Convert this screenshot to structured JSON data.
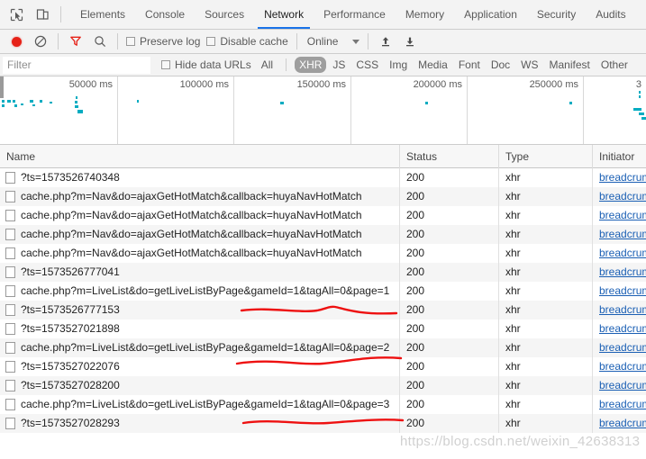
{
  "window": {
    "app": "Chrome DevTools",
    "active_panel": "Network"
  },
  "tabbar": {
    "inspect_icon": "inspect-cursor-icon",
    "device_icon": "device-toolbar-icon",
    "tabs": [
      {
        "label": "Elements",
        "active": false
      },
      {
        "label": "Console",
        "active": false
      },
      {
        "label": "Sources",
        "active": false
      },
      {
        "label": "Network",
        "active": true
      },
      {
        "label": "Performance",
        "active": false
      },
      {
        "label": "Memory",
        "active": false
      },
      {
        "label": "Application",
        "active": false
      },
      {
        "label": "Security",
        "active": false
      },
      {
        "label": "Audits",
        "active": false
      }
    ],
    "accent_color": "#1a73e8"
  },
  "toolbar": {
    "record_label": "record-button",
    "record_color": "#e62117",
    "clear_label": "clear-button",
    "filter_label": "filter-button",
    "filter_color": "#e62117",
    "search_label": "search-button",
    "preserve_log_label": "Preserve log",
    "preserve_log_checked": false,
    "disable_cache_label": "Disable cache",
    "disable_cache_checked": false,
    "throttle_value": "Online",
    "import_label": "import-har-button",
    "export_label": "export-har-button"
  },
  "filterbar": {
    "filter_placeholder": "Filter",
    "filter_value": "",
    "hide_data_urls_label": "Hide data URLs",
    "hide_data_urls_checked": false,
    "types": [
      {
        "label": "All",
        "active": false
      },
      {
        "label": "XHR",
        "active": true
      },
      {
        "label": "JS",
        "active": false
      },
      {
        "label": "CSS",
        "active": false
      },
      {
        "label": "Img",
        "active": false
      },
      {
        "label": "Media",
        "active": false
      },
      {
        "label": "Font",
        "active": false
      },
      {
        "label": "Doc",
        "active": false
      },
      {
        "label": "WS",
        "active": false
      },
      {
        "label": "Manifest",
        "active": false
      },
      {
        "label": "Other",
        "active": false
      }
    ],
    "active_pill_color": "#9e9e9e"
  },
  "overview": {
    "tick_labels": [
      "50000 ms",
      "100000 ms",
      "150000 ms",
      "200000 ms",
      "250000 ms",
      "3"
    ],
    "bar_color": "#00acc1"
  },
  "table": {
    "columns": [
      "Name",
      "Status",
      "Type",
      "Initiator"
    ],
    "rows": [
      {
        "name": "?ts=1573526740348",
        "status": "200",
        "type": "xhr",
        "initiator": "breadcrumb"
      },
      {
        "name": "cache.php?m=Nav&do=ajaxGetHotMatch&callback=huyaNavHotMatch",
        "status": "200",
        "type": "xhr",
        "initiator": "breadcrumb"
      },
      {
        "name": "cache.php?m=Nav&do=ajaxGetHotMatch&callback=huyaNavHotMatch",
        "status": "200",
        "type": "xhr",
        "initiator": "breadcrumb"
      },
      {
        "name": "cache.php?m=Nav&do=ajaxGetHotMatch&callback=huyaNavHotMatch",
        "status": "200",
        "type": "xhr",
        "initiator": "breadcrumb"
      },
      {
        "name": "cache.php?m=Nav&do=ajaxGetHotMatch&callback=huyaNavHotMatch",
        "status": "200",
        "type": "xhr",
        "initiator": "breadcrumb"
      },
      {
        "name": "?ts=1573526777041",
        "status": "200",
        "type": "xhr",
        "initiator": "breadcrumb"
      },
      {
        "name": "cache.php?m=LiveList&do=getLiveListByPage&gameId=1&tagAll=0&page=1",
        "status": "200",
        "type": "xhr",
        "initiator": "breadcrumb"
      },
      {
        "name": "?ts=1573526777153",
        "status": "200",
        "type": "xhr",
        "initiator": "breadcrumb"
      },
      {
        "name": "?ts=1573527021898",
        "status": "200",
        "type": "xhr",
        "initiator": "breadcrumb"
      },
      {
        "name": "cache.php?m=LiveList&do=getLiveListByPage&gameId=1&tagAll=0&page=2",
        "status": "200",
        "type": "xhr",
        "initiator": "breadcrumb"
      },
      {
        "name": "?ts=1573527022076",
        "status": "200",
        "type": "xhr",
        "initiator": "breadcrumb"
      },
      {
        "name": "?ts=1573527028200",
        "status": "200",
        "type": "xhr",
        "initiator": "breadcrumb"
      },
      {
        "name": "cache.php?m=LiveList&do=getLiveListByPage&gameId=1&tagAll=0&page=3",
        "status": "200",
        "type": "xhr",
        "initiator": "breadcrumb"
      },
      {
        "name": "?ts=1573527028293",
        "status": "200",
        "type": "xhr",
        "initiator": "breadcrumb"
      }
    ]
  },
  "annotations": {
    "color": "#ee1111",
    "count": 3,
    "note": "hand-drawn red underlines beneath the three getLiveListByPage rows"
  },
  "watermark": {
    "text": "https://blog.csdn.net/weixin_42638313"
  }
}
